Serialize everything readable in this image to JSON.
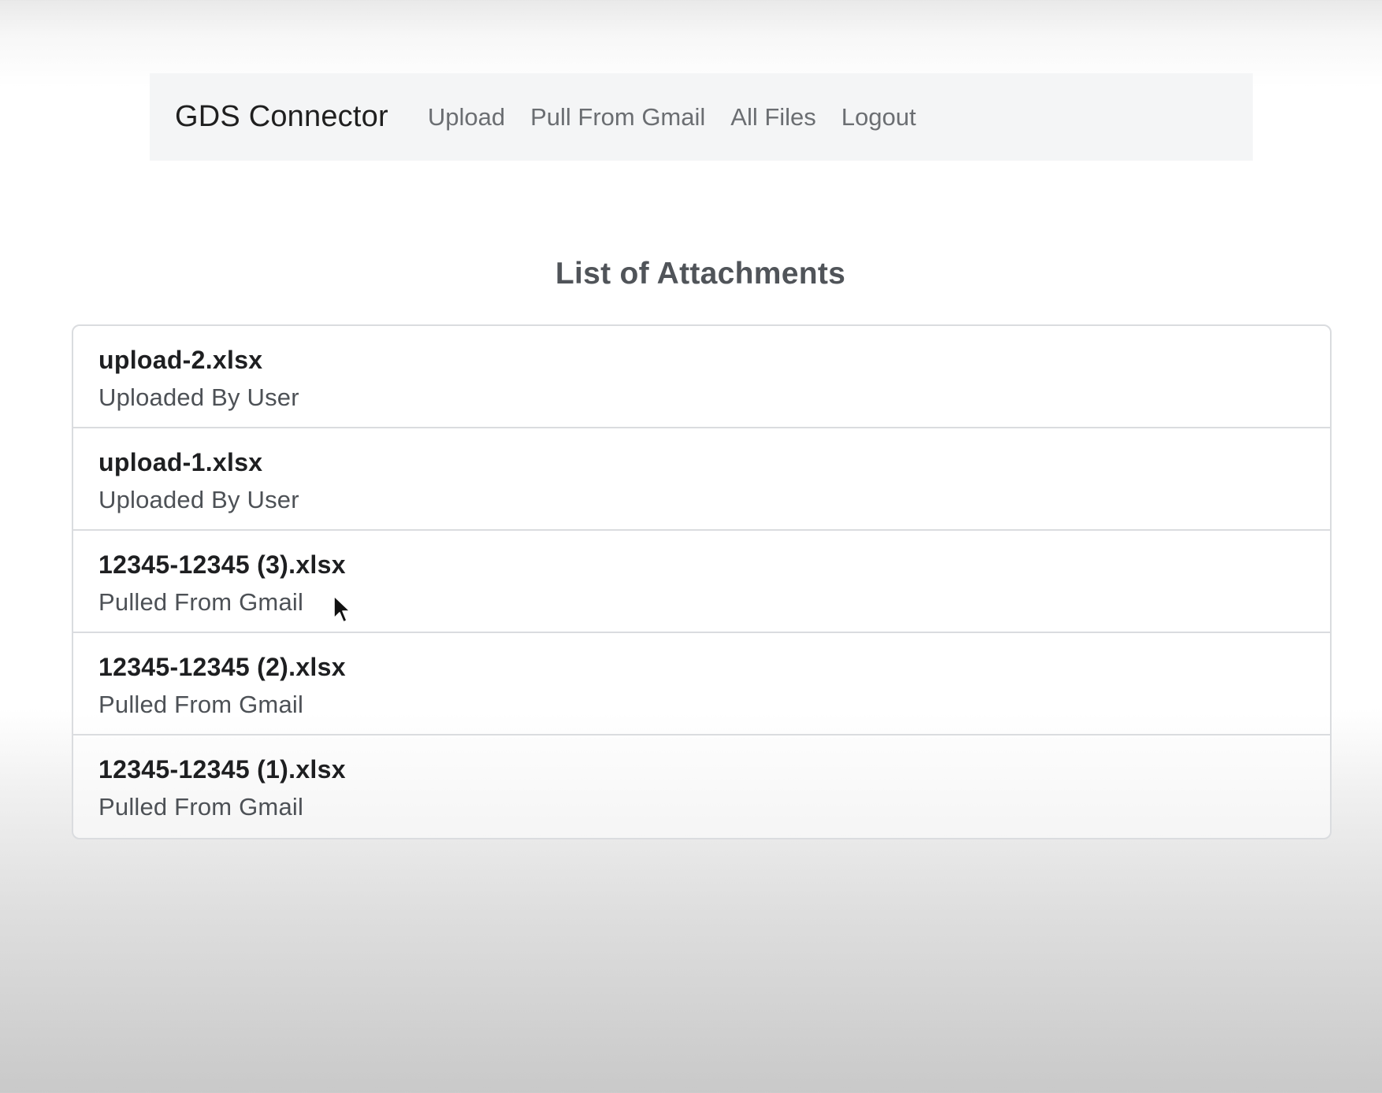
{
  "navbar": {
    "brand": "GDS Connector",
    "links": [
      {
        "label": "Upload"
      },
      {
        "label": "Pull From Gmail"
      },
      {
        "label": "All Files"
      },
      {
        "label": "Logout"
      }
    ]
  },
  "main": {
    "title": "List of Attachments",
    "attachments": [
      {
        "name": "upload-2.xlsx",
        "source": "Uploaded By User"
      },
      {
        "name": "upload-1.xlsx",
        "source": "Uploaded By User"
      },
      {
        "name": "12345-12345 (3).xlsx",
        "source": "Pulled From Gmail"
      },
      {
        "name": "12345-12345 (2).xlsx",
        "source": "Pulled From Gmail"
      },
      {
        "name": "12345-12345 (1).xlsx",
        "source": "Pulled From Gmail"
      }
    ]
  },
  "icons": {
    "cursor": "mouse-pointer-icon"
  }
}
